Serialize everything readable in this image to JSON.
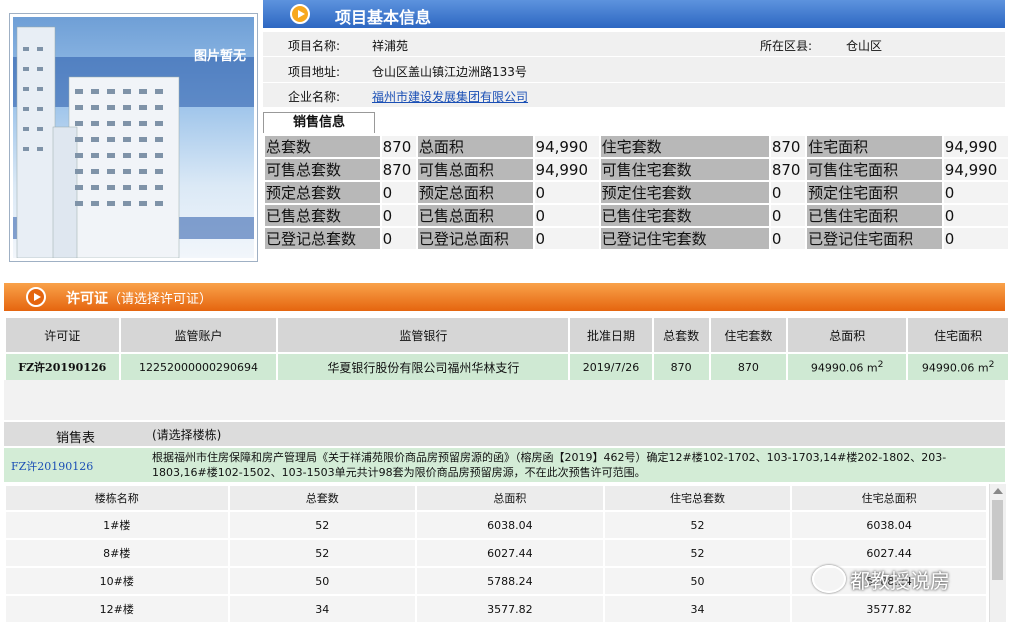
{
  "photo": {
    "no_image_text": "图片暂无"
  },
  "info": {
    "header_title": "项目基本信息",
    "project_name_label": "项目名称:",
    "project_name": "祥浦苑",
    "district_label": "所在区县:",
    "district": "仓山区",
    "address_label": "项目地址:",
    "address": "仓山区盖山镇江边洲路133号",
    "company_label": "企业名称:",
    "company": "福州市建设发展集团有限公司"
  },
  "sales": {
    "tab_label": "销售信息",
    "rows": [
      [
        [
          "总套数",
          "870"
        ],
        [
          "总面积",
          "94,990"
        ],
        [
          "住宅套数",
          "870"
        ],
        [
          "住宅面积",
          "94,990"
        ]
      ],
      [
        [
          "可售总套数",
          "870"
        ],
        [
          "可售总面积",
          "94,990"
        ],
        [
          "可售住宅套数",
          "870"
        ],
        [
          "可售住宅面积",
          "94,990"
        ]
      ],
      [
        [
          "预定总套数",
          "0"
        ],
        [
          "预定总面积",
          "0"
        ],
        [
          "预定住宅套数",
          "0"
        ],
        [
          "预定住宅面积",
          "0"
        ]
      ],
      [
        [
          "已售总套数",
          "0"
        ],
        [
          "已售总面积",
          "0"
        ],
        [
          "已售住宅套数",
          "0"
        ],
        [
          "已售住宅面积",
          "0"
        ]
      ],
      [
        [
          "已登记总套数",
          "0"
        ],
        [
          "已登记总面积",
          "0"
        ],
        [
          "已登记住宅套数",
          "0"
        ],
        [
          "已登记住宅面积",
          "0"
        ]
      ]
    ]
  },
  "permit": {
    "header_title": "许可证",
    "header_sub": "（请选择许可证）",
    "columns": [
      "许可证",
      "监管账户",
      "监管银行",
      "批准日期",
      "总套数",
      "住宅套数",
      "总面积",
      "住宅面积"
    ],
    "row": {
      "permit_no": "FZ许20190126",
      "account": "12252000000290694",
      "bank": "华夏银行股份有限公司福州华林支行",
      "date": "2019/7/26",
      "total_units": "870",
      "res_units": "870",
      "total_area": "94990.06 m",
      "res_area": "94990.06 m",
      "sup": "2"
    }
  },
  "salesform": {
    "label": "销售表",
    "hint": "(请选择楼栋)",
    "permit_no": "FZ许20190126",
    "note_line1": "根据福州市住房保障和房产管理局《关于祥浦苑限价商品房预留房源的函》（榕房函【2019】462号）确定12#楼102-1702、103-1703,14#楼202-1802、203-",
    "note_line2": "1803,16#楼102-1502、103-1503单元共计98套为限价商品房预留房源，不在此次预售许可范围。"
  },
  "buildings": {
    "columns": [
      "楼栋名称",
      "总套数",
      "总面积",
      "住宅总套数",
      "住宅总面积"
    ],
    "rows": [
      [
        "1#楼",
        "52",
        "6038.04",
        "52",
        "6038.04"
      ],
      [
        "8#楼",
        "52",
        "6027.44",
        "52",
        "6027.44"
      ],
      [
        "10#楼",
        "50",
        "5788.24",
        "50",
        "5788.24"
      ],
      [
        "12#楼",
        "34",
        "3577.82",
        "34",
        "3577.82"
      ]
    ]
  },
  "watermark": {
    "text": "都教授说房"
  },
  "colors": {
    "info_header": "#2d67c2",
    "permit_header": "#e5650f",
    "permit_row": "#cfe9d3",
    "link": "#1a4fb5"
  }
}
